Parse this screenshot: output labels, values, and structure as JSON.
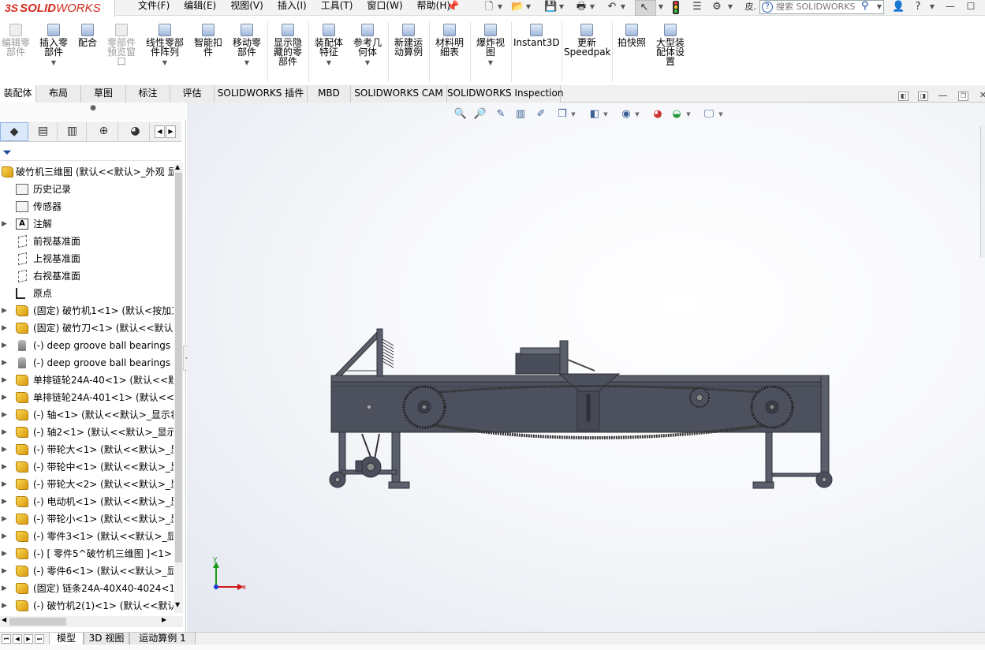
{
  "app": {
    "brand_ds": "3S",
    "brand_solid": "SOLID",
    "brand_works": "WORKS"
  },
  "menu": [
    "文件(F)",
    "编辑(E)",
    "视图(V)",
    "插入(I)",
    "工具(T)",
    "窗口(W)",
    "帮助(H)"
  ],
  "quick_access": [
    "new-doc-icon",
    "open-icon",
    "save-icon",
    "print-icon",
    "undo-icon",
    "select-icon",
    "rebuild-icon",
    "file-props-icon",
    "options-icon"
  ],
  "search": {
    "placeholder": "搜索 SOLIDWORKS",
    "help_glyph": "?",
    "user_label": "皮"
  },
  "ribbon": [
    {
      "label": "编辑零\n部件",
      "icon": "edit-component-icon",
      "dim": true
    },
    {
      "label": "插入零\n部件",
      "icon": "insert-component-icon",
      "dim": false,
      "dropdown": true
    },
    {
      "label": "配合",
      "icon": "mate-icon",
      "dim": false
    },
    {
      "label": "零部件\n预览窗\n口",
      "icon": "preview-window-icon",
      "dim": true
    },
    {
      "label": "线性零部\n件阵列",
      "icon": "linear-pattern-icon",
      "dim": false,
      "dropdown": true
    },
    {
      "label": "智能扣\n件",
      "icon": "smart-fasteners-icon",
      "dim": false
    },
    {
      "label": "移动零\n部件",
      "icon": "move-component-icon",
      "dim": false,
      "dropdown": true
    },
    {
      "label": "显示隐\n藏的零\n部件",
      "icon": "show-hidden-icon",
      "dim": false
    },
    {
      "label": "装配体\n特征",
      "icon": "assembly-features-icon",
      "dim": false,
      "dropdown": true
    },
    {
      "label": "参考几\n何体",
      "icon": "reference-geometry-icon",
      "dim": false,
      "dropdown": true
    },
    {
      "label": "新建运\n动算例",
      "icon": "new-motion-study-icon",
      "dim": false
    },
    {
      "label": "材料明\n细表",
      "icon": "bom-icon",
      "dim": false
    },
    {
      "label": "爆炸视\n图",
      "icon": "exploded-view-icon",
      "dim": false,
      "dropdown": true
    },
    {
      "label": "Instant3D",
      "icon": "instant3d-icon",
      "dim": false
    },
    {
      "label": "更新\nSpeedpak",
      "icon": "speedpak-icon",
      "dim": false
    },
    {
      "label": "拍快照",
      "icon": "snapshot-icon",
      "dim": false
    },
    {
      "label": "大型装\n配体设\n置",
      "icon": "large-assembly-icon",
      "dim": false
    }
  ],
  "tabs": [
    "装配体",
    "布局",
    "草图",
    "标注",
    "评估",
    "SOLIDWORKS 插件",
    "MBD",
    "SOLIDWORKS CAM",
    "SOLIDWORKS Inspection"
  ],
  "active_tab": "装配体",
  "panel_tabs": [
    "feature-manager-icon",
    "property-manager-icon",
    "configuration-manager-icon",
    "dimxpert-icon",
    "display-manager-icon"
  ],
  "tree": {
    "root": "破竹机三维图  (默认<<默认>_外观 显",
    "items": [
      {
        "label": "历史记录",
        "icon": "history-icon",
        "kind": "folder",
        "expand": false
      },
      {
        "label": "传感器",
        "icon": "sensor-icon",
        "kind": "folder",
        "expand": false
      },
      {
        "label": "注解",
        "icon": "annotation-icon",
        "kind": "ann",
        "expand": true
      },
      {
        "label": "前视基准面",
        "icon": "plane-icon",
        "kind": "plane",
        "expand": false
      },
      {
        "label": "上视基准面",
        "icon": "plane-icon",
        "kind": "plane",
        "expand": false
      },
      {
        "label": "右视基准面",
        "icon": "plane-icon",
        "kind": "plane",
        "expand": false
      },
      {
        "label": "原点",
        "icon": "origin-icon",
        "kind": "origin",
        "expand": false
      },
      {
        "label": "(固定) 破竹机1<1> (默认<按加工",
        "icon": "part-icon",
        "kind": "part",
        "expand": true
      },
      {
        "label": "(固定) 破竹刀<1> (默认<<默认>_",
        "icon": "part-icon",
        "kind": "part",
        "expand": true
      },
      {
        "label": "(-) deep groove ball bearings",
        "icon": "bearing-icon",
        "kind": "bolt",
        "expand": true
      },
      {
        "label": "(-) deep groove ball bearings",
        "icon": "bearing-icon",
        "kind": "bolt",
        "expand": true
      },
      {
        "label": "单排链轮24A-40<1> (默认<<默",
        "icon": "part-icon",
        "kind": "part",
        "expand": true
      },
      {
        "label": "单排链轮24A-401<1> (默认<<默",
        "icon": "part-icon",
        "kind": "part",
        "expand": true
      },
      {
        "label": "(-) 轴<1> (默认<<默认>_显示状",
        "icon": "part-icon",
        "kind": "part",
        "expand": true
      },
      {
        "label": "(-) 轴2<1> (默认<<默认>_显示",
        "icon": "part-icon",
        "kind": "part",
        "expand": true
      },
      {
        "label": "(-) 带轮大<1> (默认<<默认>_显",
        "icon": "part-icon",
        "kind": "part",
        "expand": true
      },
      {
        "label": "(-) 带轮中<1> (默认<<默认>_显",
        "icon": "part-icon",
        "kind": "part",
        "expand": true
      },
      {
        "label": "(-) 带轮大<2> (默认<<默认>_显",
        "icon": "part-icon",
        "kind": "part",
        "expand": true
      },
      {
        "label": "(-) 电动机<1> (默认<<默认>_显",
        "icon": "part-icon",
        "kind": "part",
        "expand": true
      },
      {
        "label": "(-) 带轮小<1> (默认<<默认>_显",
        "icon": "part-icon",
        "kind": "part",
        "expand": true
      },
      {
        "label": "(-) 零件3<1> (默认<<默认>_显",
        "icon": "part-icon",
        "kind": "part",
        "expand": true
      },
      {
        "label": "(-) [ 零件5^破竹机三维图 ]<1>",
        "icon": "part-icon",
        "kind": "part",
        "expand": true
      },
      {
        "label": "(-) 零件6<1> (默认<<默认>_显",
        "icon": "part-icon",
        "kind": "part",
        "expand": true
      },
      {
        "label": "(固定) 链条24A-40X40-4024<1",
        "icon": "part-icon",
        "kind": "part",
        "expand": true
      },
      {
        "label": "(-) 破竹机2(1)<1> (默认<<默认",
        "icon": "part-icon",
        "kind": "part",
        "expand": true
      }
    ]
  },
  "heads_up": [
    "zoom-to-fit-icon",
    "zoom-area-icon",
    "previous-view-icon",
    "section-view-icon",
    "dynamic-annotation-icon",
    "view-orientation-icon",
    "display-style-icon",
    "hide-show-icon",
    "edit-appearance-icon",
    "apply-scene-icon",
    "view-settings-icon"
  ],
  "triad": {
    "x": "x",
    "y": "y"
  },
  "bottom_tabs": [
    "模型",
    "3D 视图",
    "运动算例 1"
  ],
  "active_bottom_tab": "模型",
  "colors": {
    "brand": "#d52b1e",
    "model": "#505562",
    "accent": "#1f4e9b"
  }
}
